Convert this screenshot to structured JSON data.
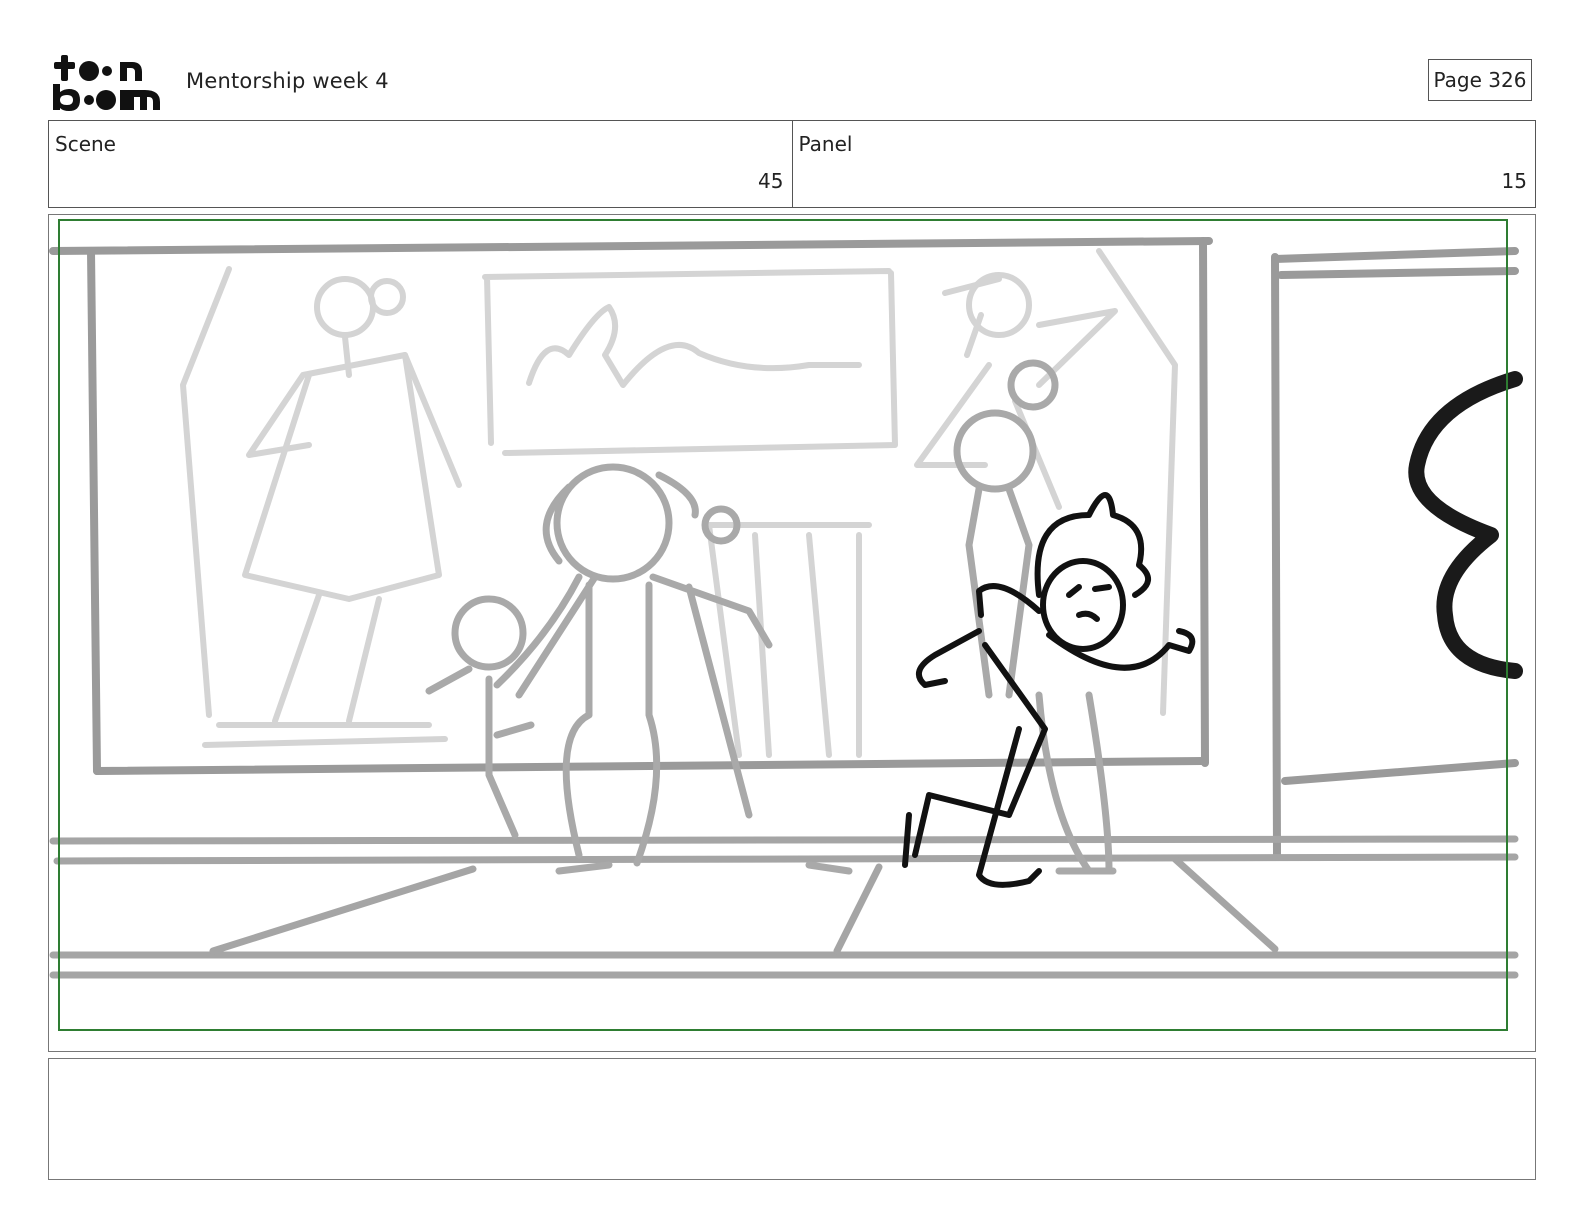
{
  "header": {
    "logo_alt": "toon boom",
    "project_title": "Mentorship week 4",
    "page_label": "Page 326"
  },
  "info": {
    "scene_label": "Scene",
    "scene_value": "45",
    "panel_label": "Panel",
    "panel_value": "15"
  },
  "panel": {
    "description_icons": [
      "storefront-sketch",
      "mannequin-sketch",
      "character-sketch"
    ],
    "safe_area_color": "#2e7d32",
    "sketch_gray": "#a9a9a9",
    "sketch_light_gray": "#d4d4d4",
    "ink_color": "#111111"
  },
  "notes": {
    "text": ""
  }
}
